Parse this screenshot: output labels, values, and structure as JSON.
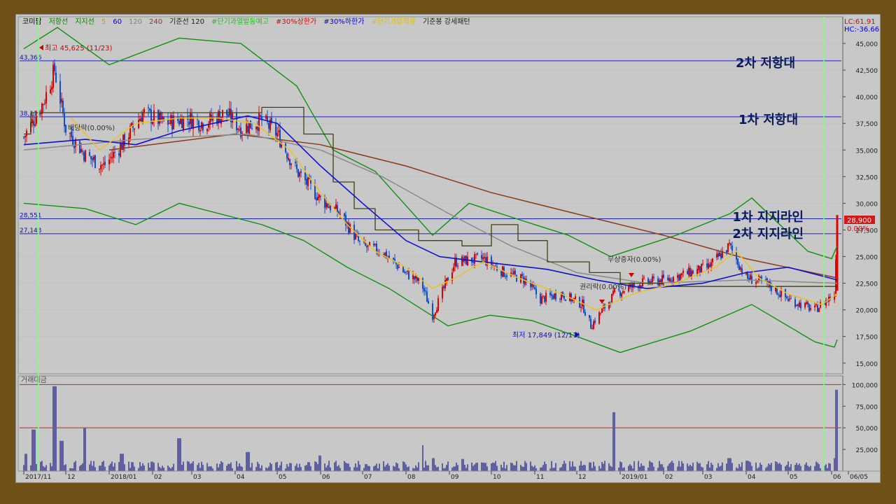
{
  "header": {
    "items": [
      {
        "text": "코미팜",
        "color": "#000000"
      },
      {
        "text": "저항선",
        "color": "#008000"
      },
      {
        "text": "지지선",
        "color": "#008000"
      },
      {
        "text": "5",
        "color": "#c0a000"
      },
      {
        "text": "60",
        "color": "#0000c0"
      },
      {
        "text": "120",
        "color": "#808080"
      },
      {
        "text": "240",
        "color": "#8b3a1a"
      },
      {
        "text": "기준선 120",
        "color": "#202020"
      },
      {
        "text": "#단기과열발동예고",
        "color": "#20c020"
      },
      {
        "text": "#30%상한가",
        "color": "#e00000"
      },
      {
        "text": "#30%하한가",
        "color": "#0000e0"
      },
      {
        "text": "#단기과열적용",
        "color": "#e0c000"
      },
      {
        "text": "기준봉 강세패턴",
        "color": "#202020"
      }
    ],
    "lc": "LC:61.91",
    "hc": "HC:-36.66"
  },
  "annotations": {
    "resistance_2": "2차 저항대",
    "resistance_1": "1차 저항대",
    "support_1": "1차 지지라인",
    "support_2": "2차 지지라인",
    "high": "최고 45,625 (11/23)",
    "low": "최저 17,849 (12/11)",
    "dividend": "배당락(0.00%)",
    "bonus": "무상증자(0.00%)",
    "rights": "권리락(0.00%)"
  },
  "levels": [
    {
      "label": "43,366",
      "value": 43366
    },
    {
      "label": "38,112",
      "value": 38112
    },
    {
      "label": "28,551",
      "value": 28551
    },
    {
      "label": "27,143",
      "value": 27143
    }
  ],
  "price_tag": {
    "price": "28,900",
    "change": "0.00%"
  },
  "volume_label": "거래대금",
  "colors": {
    "up": "#e00000",
    "down": "#1050d0",
    "ma5": "#f0c020",
    "ma60": "#1010d0",
    "ma120": "#8a8a8a",
    "ma240": "#8b3a1a",
    "baseline": "#404010",
    "bollinger": "#109010",
    "hline": "#2020c0",
    "volume": "#6060a0",
    "volume_limit": "#d02020",
    "marker": "#80ff80"
  },
  "chart_data": [
    {
      "type": "candlestick",
      "title": "코미팜",
      "ylim": [
        14000,
        47500
      ],
      "y_ticks": [
        "45,000",
        "42,500",
        "40,000",
        "37,500",
        "35,000",
        "32,500",
        "30,000",
        "27,500",
        "25,000",
        "22,500",
        "20,000",
        "17,500",
        "15,000"
      ],
      "x_ticks": [
        "2017/11",
        "12",
        "2018/01",
        "02",
        "03",
        "04",
        "05",
        "06",
        "07",
        "08",
        "09",
        "10",
        "11",
        "12",
        "2019/01",
        "02",
        "03",
        "04",
        "05",
        "06",
        "06/05"
      ],
      "close_path": [
        {
          "x": "2017-11-01",
          "y": 36200
        },
        {
          "x": "2017-11-15",
          "y": 39500
        },
        {
          "x": "2017-11-23",
          "y": 42500
        },
        {
          "x": "2017-12-01",
          "y": 37000
        },
        {
          "x": "2017-12-15",
          "y": 34500
        },
        {
          "x": "2017-12-28",
          "y": 33500
        },
        {
          "x": "2018-01-10",
          "y": 35500
        },
        {
          "x": "2018-01-25",
          "y": 38500
        },
        {
          "x": "2018-02-10",
          "y": 37500
        },
        {
          "x": "2018-02-25",
          "y": 38000
        },
        {
          "x": "2018-03-10",
          "y": 37500
        },
        {
          "x": "2018-03-25",
          "y": 38500
        },
        {
          "x": "2018-04-05",
          "y": 37000
        },
        {
          "x": "2018-04-20",
          "y": 37800
        },
        {
          "x": "2018-05-01",
          "y": 36500
        },
        {
          "x": "2018-05-15",
          "y": 33000
        },
        {
          "x": "2018-05-31",
          "y": 30500
        },
        {
          "x": "2018-06-15",
          "y": 29000
        },
        {
          "x": "2018-06-30",
          "y": 26000
        },
        {
          "x": "2018-07-15",
          "y": 25500
        },
        {
          "x": "2018-07-31",
          "y": 23500
        },
        {
          "x": "2018-08-12",
          "y": 22500
        },
        {
          "x": "2018-08-20",
          "y": 19500
        },
        {
          "x": "2018-09-05",
          "y": 24500
        },
        {
          "x": "2018-09-25",
          "y": 24800
        },
        {
          "x": "2018-10-10",
          "y": 23500
        },
        {
          "x": "2018-10-25",
          "y": 22800
        },
        {
          "x": "2018-11-05",
          "y": 21000
        },
        {
          "x": "2018-11-20",
          "y": 21500
        },
        {
          "x": "2018-12-05",
          "y": 20500
        },
        {
          "x": "2018-12-11",
          "y": 18500
        },
        {
          "x": "2018-12-28",
          "y": 21500
        },
        {
          "x": "2019-01-15",
          "y": 22500
        },
        {
          "x": "2019-02-01",
          "y": 22800
        },
        {
          "x": "2019-02-20",
          "y": 23500
        },
        {
          "x": "2019-03-05",
          "y": 24000
        },
        {
          "x": "2019-03-20",
          "y": 26000
        },
        {
          "x": "2019-04-01",
          "y": 23000
        },
        {
          "x": "2019-04-15",
          "y": 22500
        },
        {
          "x": "2019-05-01",
          "y": 21000
        },
        {
          "x": "2019-05-20",
          "y": 20000
        },
        {
          "x": "2019-06-03",
          "y": 21500
        },
        {
          "x": "2019-06-05",
          "y": 28900
        }
      ],
      "ma5": [
        {
          "x": "2017-12-05",
          "y": 38000
        },
        {
          "x": "2017-12-25",
          "y": 35000
        },
        {
          "x": "2018-01-20",
          "y": 37500
        },
        {
          "x": "2018-02-20",
          "y": 38000
        },
        {
          "x": "2018-03-20",
          "y": 38000
        },
        {
          "x": "2018-04-15",
          "y": 37500
        },
        {
          "x": "2018-05-10",
          "y": 35000
        },
        {
          "x": "2018-06-01",
          "y": 31000
        },
        {
          "x": "2018-06-20",
          "y": 28000
        },
        {
          "x": "2018-07-10",
          "y": 25500
        },
        {
          "x": "2018-08-01",
          "y": 24000
        },
        {
          "x": "2018-08-20",
          "y": 22000
        },
        {
          "x": "2018-09-05",
          "y": 23000
        },
        {
          "x": "2018-09-25",
          "y": 24500
        },
        {
          "x": "2018-10-20",
          "y": 23000
        },
        {
          "x": "2018-11-20",
          "y": 21500
        },
        {
          "x": "2018-12-15",
          "y": 20000
        },
        {
          "x": "2019-01-10",
          "y": 21500
        },
        {
          "x": "2019-02-10",
          "y": 22500
        },
        {
          "x": "2019-03-10",
          "y": 24000
        },
        {
          "x": "2019-03-25",
          "y": 25500
        },
        {
          "x": "2019-04-10",
          "y": 23000
        },
        {
          "x": "2019-05-01",
          "y": 21500
        },
        {
          "x": "2019-05-25",
          "y": 20500
        },
        {
          "x": "2019-06-05",
          "y": 21500
        }
      ],
      "ma60": [
        {
          "x": "2017-11-01",
          "y": 35500
        },
        {
          "x": "2017-12-15",
          "y": 36000
        },
        {
          "x": "2018-01-20",
          "y": 35500
        },
        {
          "x": "2018-02-20",
          "y": 36800
        },
        {
          "x": "2018-04-10",
          "y": 38200
        },
        {
          "x": "2018-05-01",
          "y": 37500
        },
        {
          "x": "2018-06-01",
          "y": 33500
        },
        {
          "x": "2018-07-01",
          "y": 30000
        },
        {
          "x": "2018-08-01",
          "y": 26500
        },
        {
          "x": "2018-08-25",
          "y": 25000
        },
        {
          "x": "2018-09-25",
          "y": 24500
        },
        {
          "x": "2018-11-10",
          "y": 23800
        },
        {
          "x": "2018-12-15",
          "y": 22800
        },
        {
          "x": "2019-01-20",
          "y": 22000
        },
        {
          "x": "2019-03-01",
          "y": 22500
        },
        {
          "x": "2019-04-01",
          "y": 23500
        },
        {
          "x": "2019-05-01",
          "y": 24000
        },
        {
          "x": "2019-06-05",
          "y": 22800
        }
      ],
      "ma120": [
        {
          "x": "2017-11-01",
          "y": 35000
        },
        {
          "x": "2018-01-20",
          "y": 36000
        },
        {
          "x": "2018-04-10",
          "y": 36500
        },
        {
          "x": "2018-06-01",
          "y": 35000
        },
        {
          "x": "2018-07-15",
          "y": 32500
        },
        {
          "x": "2018-09-01",
          "y": 29000
        },
        {
          "x": "2018-10-15",
          "y": 26000
        },
        {
          "x": "2018-12-01",
          "y": 23500
        },
        {
          "x": "2019-01-20",
          "y": 22500
        },
        {
          "x": "2019-04-01",
          "y": 22800
        },
        {
          "x": "2019-06-05",
          "y": 22500
        }
      ],
      "ma240": [
        {
          "x": "2018-01-01",
          "y": 35000
        },
        {
          "x": "2018-04-01",
          "y": 36500
        },
        {
          "x": "2018-06-01",
          "y": 35500
        },
        {
          "x": "2018-08-01",
          "y": 33500
        },
        {
          "x": "2018-10-01",
          "y": 31000
        },
        {
          "x": "2018-12-01",
          "y": 29000
        },
        {
          "x": "2019-02-01",
          "y": 27000
        },
        {
          "x": "2019-04-01",
          "y": 24800
        },
        {
          "x": "2019-06-05",
          "y": 23000
        }
      ],
      "baseline_120": [
        {
          "x": "2017-11-01",
          "y": 36500
        },
        {
          "x": "2017-11-06",
          "y": 38500
        },
        {
          "x": "2018-04-15",
          "y": 38500
        },
        {
          "x": "2018-04-20",
          "y": 39000
        },
        {
          "x": "2018-05-10",
          "y": 39000
        },
        {
          "x": "2018-05-20",
          "y": 36500
        },
        {
          "x": "2018-06-10",
          "y": 32000
        },
        {
          "x": "2018-06-25",
          "y": 29500
        },
        {
          "x": "2018-07-10",
          "y": 27500
        },
        {
          "x": "2018-08-10",
          "y": 26500
        },
        {
          "x": "2018-09-10",
          "y": 26000
        },
        {
          "x": "2018-10-01",
          "y": 28000
        },
        {
          "x": "2018-10-20",
          "y": 26500
        },
        {
          "x": "2018-11-10",
          "y": 24500
        },
        {
          "x": "2018-12-10",
          "y": 23500
        },
        {
          "x": "2019-01-01",
          "y": 22500
        },
        {
          "x": "2019-02-01",
          "y": 22200
        },
        {
          "x": "2019-06-05",
          "y": 22200
        }
      ],
      "bollinger_upper": [
        {
          "x": "2017-11-01",
          "y": 44500
        },
        {
          "x": "2017-11-25",
          "y": 46500
        },
        {
          "x": "2018-01-01",
          "y": 43000
        },
        {
          "x": "2018-02-20",
          "y": 45500
        },
        {
          "x": "2018-04-05",
          "y": 45000
        },
        {
          "x": "2018-05-15",
          "y": 41000
        },
        {
          "x": "2018-06-10",
          "y": 35000
        },
        {
          "x": "2018-07-10",
          "y": 33000
        },
        {
          "x": "2018-08-20",
          "y": 27000
        },
        {
          "x": "2018-09-15",
          "y": 30000
        },
        {
          "x": "2018-10-20",
          "y": 28500
        },
        {
          "x": "2018-11-25",
          "y": 27000
        },
        {
          "x": "2018-12-25",
          "y": 25000
        },
        {
          "x": "2019-02-10",
          "y": 27000
        },
        {
          "x": "2019-03-20",
          "y": 29000
        },
        {
          "x": "2019-04-05",
          "y": 30500
        },
        {
          "x": "2019-05-15",
          "y": 25500
        },
        {
          "x": "2019-06-01",
          "y": 24800
        },
        {
          "x": "2019-06-05",
          "y": 26000
        }
      ],
      "bollinger_lower": [
        {
          "x": "2017-11-01",
          "y": 30000
        },
        {
          "x": "2017-12-15",
          "y": 29500
        },
        {
          "x": "2018-01-20",
          "y": 28000
        },
        {
          "x": "2018-02-20",
          "y": 30000
        },
        {
          "x": "2018-04-20",
          "y": 28000
        },
        {
          "x": "2018-05-20",
          "y": 26500
        },
        {
          "x": "2018-06-20",
          "y": 24000
        },
        {
          "x": "2018-07-20",
          "y": 22000
        },
        {
          "x": "2018-08-31",
          "y": 18500
        },
        {
          "x": "2018-09-30",
          "y": 19500
        },
        {
          "x": "2018-10-30",
          "y": 19000
        },
        {
          "x": "2018-12-01",
          "y": 17500
        },
        {
          "x": "2019-01-01",
          "y": 16000
        },
        {
          "x": "2019-02-20",
          "y": 18000
        },
        {
          "x": "2019-04-05",
          "y": 20500
        },
        {
          "x": "2019-05-20",
          "y": 17000
        },
        {
          "x": "2019-06-03",
          "y": 16500
        },
        {
          "x": "2019-06-05",
          "y": 17200
        }
      ]
    },
    {
      "type": "bar",
      "title": "거래대금",
      "ylim": [
        0,
        110000
      ],
      "y_ticks": [
        "100,000",
        "75,000",
        "50,000",
        "25,000"
      ],
      "limit_lines": [
        100000,
        50000
      ],
      "values": [
        {
          "x": "2017-11-03",
          "y": 20000
        },
        {
          "x": "2017-11-08",
          "y": 48000
        },
        {
          "x": "2017-11-23",
          "y": 98000
        },
        {
          "x": "2017-11-28",
          "y": 35000
        },
        {
          "x": "2017-12-15",
          "y": 50000
        },
        {
          "x": "2018-01-10",
          "y": 20000
        },
        {
          "x": "2018-02-20",
          "y": 38000
        },
        {
          "x": "2018-04-10",
          "y": 22000
        },
        {
          "x": "2018-06-01",
          "y": 18000
        },
        {
          "x": "2018-08-12",
          "y": 30000
        },
        {
          "x": "2018-08-20",
          "y": 15000
        },
        {
          "x": "2018-09-10",
          "y": 14000
        },
        {
          "x": "2018-12-10",
          "y": 10000
        },
        {
          "x": "2018-12-28",
          "y": 68000
        },
        {
          "x": "2019-03-20",
          "y": 15000
        },
        {
          "x": "2019-04-01",
          "y": 12000
        },
        {
          "x": "2019-06-03",
          "y": 15000
        },
        {
          "x": "2019-06-05",
          "y": 94000
        }
      ]
    }
  ]
}
